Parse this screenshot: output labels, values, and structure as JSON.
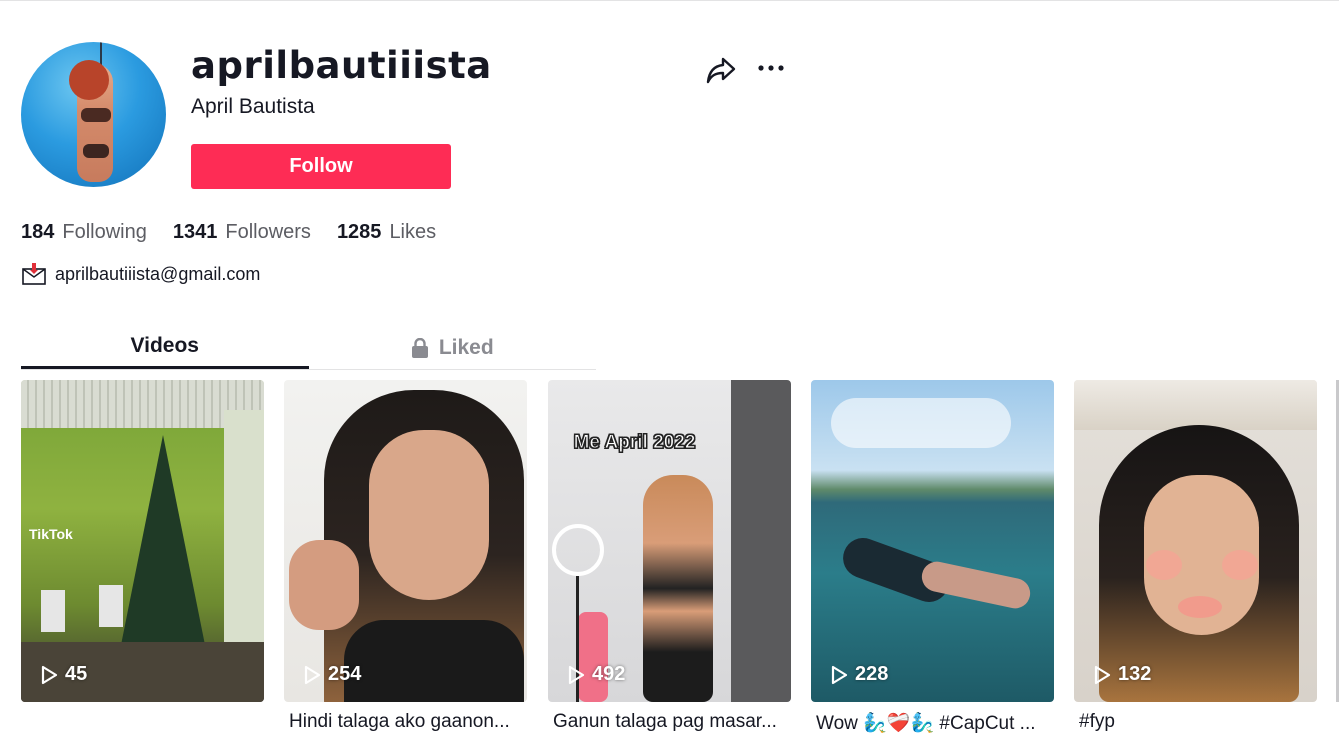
{
  "profile": {
    "username": "aprilbautiiista",
    "nickname": "April Bautista",
    "follow_label": "Follow",
    "bio_email": "aprilbautiiista@gmail.com",
    "avatar_icon": "avatar-photo"
  },
  "stats": [
    {
      "num": "184",
      "label": "Following"
    },
    {
      "num": "1341",
      "label": "Followers"
    },
    {
      "num": "1285",
      "label": "Likes"
    }
  ],
  "tabs": {
    "videos": "Videos",
    "liked": "Liked"
  },
  "videos": [
    {
      "plays": "45",
      "caption": "",
      "thumb_text": "",
      "watermark": "TikTok"
    },
    {
      "plays": "254",
      "caption": "Hindi talaga ako gaanon..."
    },
    {
      "plays": "492",
      "caption": "Ganun talaga pag masar...",
      "thumb_text": "Me April 2022"
    },
    {
      "plays": "228",
      "caption": "Wow 🧞‍♂️❤️‍🩹🧞‍♂️ #CapCut ..."
    },
    {
      "plays": "132",
      "caption": "#fyp"
    }
  ],
  "icons": {
    "share": "share-icon",
    "more": "more-icon",
    "mail": "mail-icon",
    "lock": "lock-icon",
    "play": "play-icon"
  },
  "colors": {
    "follow": "#fe2c55",
    "text": "#161823",
    "muted": "#5c5d63"
  }
}
